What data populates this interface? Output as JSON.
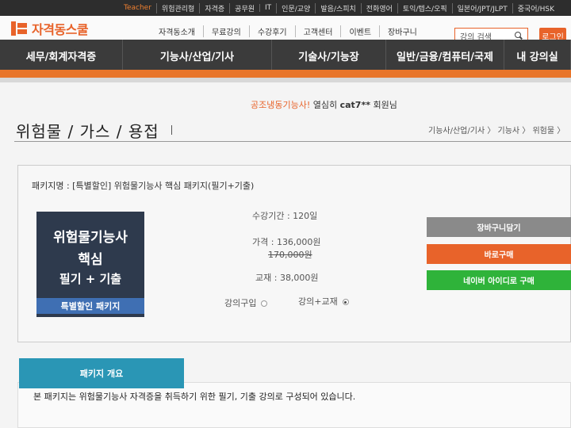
{
  "top_strip": [
    "Teacher",
    "위험관리형",
    "자격증",
    "공무원",
    "IT",
    "인문/교양",
    "발음/스피치",
    "전화영어",
    "토익/텝스/오픽",
    "일본어/JPT/JLPT",
    "중국어/HSK"
  ],
  "logo_text": "자격동스쿨",
  "top_nav": [
    "자격동소개",
    "무료강의",
    "수강후기",
    "고객센터",
    "이벤트",
    "장바구니"
  ],
  "search": {
    "placeholder": "강의 검색"
  },
  "login_label": "로그인",
  "main_nav": [
    "세무/회계자격증",
    "기능사/산업/기사",
    "기술사/기능장",
    "일반/금융/컴퓨터/국제",
    "내 강의실"
  ],
  "welcome": {
    "prefix": "공조냉동기능사!",
    "middle": " 열심히 ",
    "user": "cat7**",
    "suffix": " 회원님"
  },
  "page_title": "위험물 / 가스 / 용접",
  "breadcrumb": "기능사/산업/기사 〉 기능사 〉 위험물 〉",
  "package": {
    "name": "패키지명 : [특별할인] 위험물기능사 핵심 패키지(필기+기출)",
    "thumb_line1": "위험물기능사",
    "thumb_line2": "핵심",
    "thumb_line3": "필기 + 기출",
    "thumb_badge": "특별할인 패키지",
    "period": "수강기간 : 120일",
    "price": "가격 : 136,000원",
    "original_price": "170,000원",
    "book_price": "교재 : 38,000원",
    "option_lecture": "강의구입",
    "option_bundle": "강의+교재",
    "selected_option": "강의+교재"
  },
  "buttons": {
    "cart": "장바구니담기",
    "buy": "바로구매",
    "naver": "네이버 아이디로 구매"
  },
  "overview": {
    "tab": "패키지 개요",
    "text": "본 패키지는 위험물기능사 자격증을 취득하기 위한 필기, 기출 강의로 구성되어 있습니다."
  },
  "colors": {
    "accent": "#e8632a",
    "nav_bg": "#3b3b3b",
    "naver_green": "#2fb33a",
    "tab_blue": "#2a96b5"
  }
}
